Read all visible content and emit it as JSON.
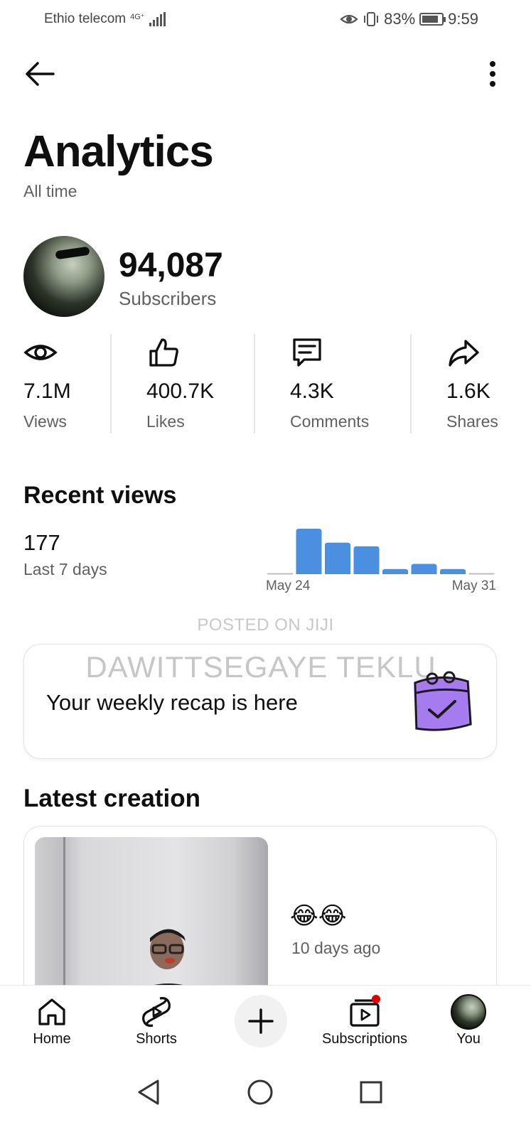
{
  "status_bar": {
    "carrier": "Ethio telecom",
    "network": "4G⁺",
    "battery_percent": "83%",
    "battery_level": 0.83,
    "time": "9:59"
  },
  "header": {
    "back_icon": "arrow-left-icon",
    "more_icon": "more-vertical-icon"
  },
  "page": {
    "title": "Analytics",
    "subtitle": "All time"
  },
  "channel": {
    "subscriber_count": "94,087",
    "subscriber_label": "Subscribers"
  },
  "stats": [
    {
      "icon": "eye-icon",
      "value": "7.1M",
      "label": "Views"
    },
    {
      "icon": "thumbs-up-icon",
      "value": "400.7K",
      "label": "Likes"
    },
    {
      "icon": "comment-icon",
      "value": "4.3K",
      "label": "Comments"
    },
    {
      "icon": "share-icon",
      "value": "1.6K",
      "label": "Shares"
    }
  ],
  "recent_views": {
    "title": "Recent views",
    "count": "177",
    "period": "Last 7 days",
    "x_start_label": "May 24",
    "x_end_label": "May 31"
  },
  "chart_data": {
    "type": "bar",
    "categories": [
      "May 24",
      "May 25",
      "May 26",
      "May 27",
      "May 28",
      "May 29",
      "May 30",
      "May 31"
    ],
    "values": [
      0,
      62,
      43,
      38,
      7,
      14,
      7,
      0
    ],
    "title": "",
    "xlabel": "",
    "ylabel": "",
    "bar_color": "#4a8fe0",
    "grid": false
  },
  "watermark": {
    "line1": "POSTED ON JIJI",
    "line2": "DAWITTSEGAYE TEKLU"
  },
  "recap": {
    "text": "Your weekly recap is here",
    "icon": "calendar-check-icon"
  },
  "latest_creation": {
    "title": "Latest creation",
    "caption": "😂😂",
    "time_ago": "10 days ago"
  },
  "bottom_nav": {
    "items": [
      {
        "label": "Home",
        "icon": "home-icon"
      },
      {
        "label": "Shorts",
        "icon": "shorts-icon"
      },
      {
        "label": "",
        "icon": "plus-icon"
      },
      {
        "label": "Subscriptions",
        "icon": "subscriptions-icon"
      },
      {
        "label": "You",
        "icon": "avatar"
      }
    ],
    "notification_dot_color": "#e00000"
  },
  "android_nav": {
    "back_icon": "triangle-back-icon",
    "home_icon": "circle-home-icon",
    "recents_icon": "square-recents-icon"
  }
}
